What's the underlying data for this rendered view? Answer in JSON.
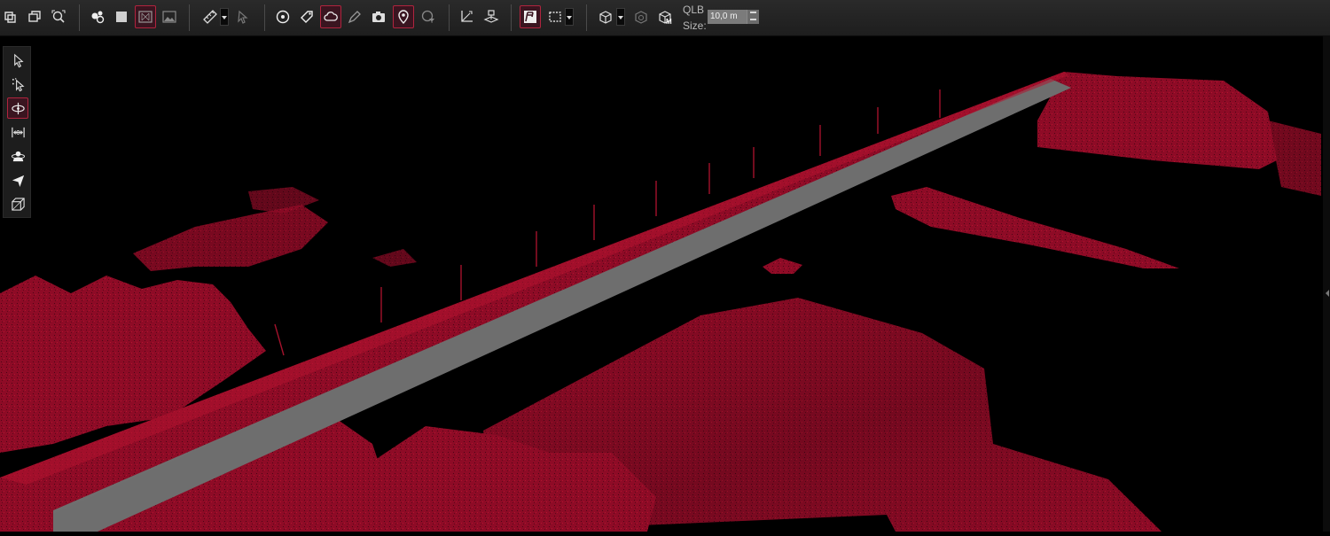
{
  "toolbar": {
    "qlb_label": "QLB",
    "size_label": "Size:",
    "size_value": "10,0 m"
  },
  "sidebar": {
    "active_tool": "orbit"
  },
  "viewport": {
    "content": "point-cloud-bridge",
    "point_color": "#8e0b26",
    "deck_color": "#7a7a7a"
  }
}
